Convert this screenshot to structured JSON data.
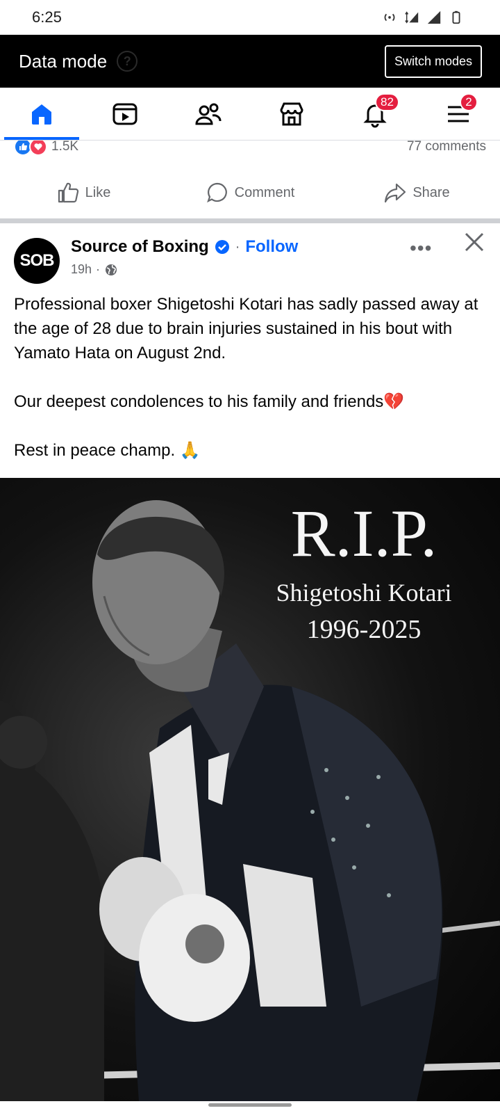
{
  "status_bar": {
    "time": "6:25",
    "network": "4G",
    "icons": [
      "hotspot-icon",
      "network-4g-icon",
      "signal-icon",
      "signal-icon",
      "battery-icon"
    ]
  },
  "data_mode": {
    "title": "Data mode",
    "help": "?",
    "switch_label": "Switch modes"
  },
  "tabs": [
    {
      "name": "home",
      "icon": "home-icon",
      "active": true
    },
    {
      "name": "video",
      "icon": "video-icon"
    },
    {
      "name": "friends",
      "icon": "friends-icon"
    },
    {
      "name": "marketplace",
      "icon": "marketplace-icon"
    },
    {
      "name": "notifications",
      "icon": "bell-icon",
      "badge": "82"
    },
    {
      "name": "menu",
      "icon": "menu-icon",
      "badge": "2"
    }
  ],
  "previous_post": {
    "reaction_count": "1.5K",
    "comments": "77 comments",
    "actions": {
      "like": "Like",
      "comment": "Comment",
      "share": "Share"
    }
  },
  "post": {
    "avatar_text": "SOB",
    "page_name": "Source of Boxing",
    "dot": "·",
    "follow": "Follow",
    "time": "19h",
    "time_dot": "·",
    "text1": "Professional boxer Shigetoshi Kotari has sadly passed away at the age of 28 due to brain injuries sustained in his bout with Yamato Hata on August 2nd.",
    "text2": "Our deepest condolences to his family and friends💔",
    "text3": "Rest in peace champ. 🙏",
    "image": {
      "title": "R.I.P.",
      "name": "Shigetoshi Kotari",
      "years": "1996-2025"
    }
  },
  "colors": {
    "accent": "#0866ff",
    "badge": "#e41e3f",
    "like": "#1877f2",
    "love": "#f33e58",
    "secondary_text": "#65676b"
  }
}
